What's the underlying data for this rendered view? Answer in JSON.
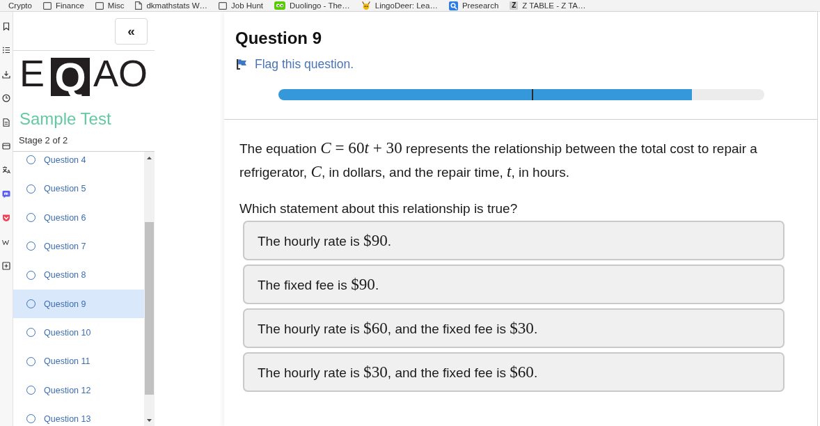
{
  "bookmarks_bar": {
    "items": [
      {
        "kind": "plain",
        "label": "Crypto"
      },
      {
        "kind": "folder",
        "label": "Finance"
      },
      {
        "kind": "folder",
        "label": "Misc"
      },
      {
        "kind": "page",
        "label": "dkmathstats W…"
      },
      {
        "kind": "folder",
        "label": "Job Hunt"
      },
      {
        "kind": "owl",
        "label": "Duolingo - The…"
      },
      {
        "kind": "deer",
        "label": "LingoDeer: Lea…"
      },
      {
        "kind": "tile",
        "label": "Presearch"
      },
      {
        "kind": "letter",
        "glyph": "Z",
        "label": "Z TABLE - Z TA…"
      }
    ]
  },
  "sidebar": {
    "collapse_button": "«",
    "logo": "EQAO",
    "title": "Sample Test",
    "stage": "Stage 2 of 2",
    "questions": [
      {
        "label": "Question 4",
        "selected": false
      },
      {
        "label": "Question 5",
        "selected": false
      },
      {
        "label": "Question 6",
        "selected": false
      },
      {
        "label": "Question 7",
        "selected": false
      },
      {
        "label": "Question 8",
        "selected": false
      },
      {
        "label": "Question 9",
        "selected": true
      },
      {
        "label": "Question 10",
        "selected": false
      },
      {
        "label": "Question 11",
        "selected": false
      },
      {
        "label": "Question 12",
        "selected": false
      },
      {
        "label": "Question 13",
        "selected": false
      }
    ]
  },
  "main": {
    "title": "Question 9",
    "flag_link": "Flag this question.",
    "progress": {
      "stages": [
        {
          "level": 1
        },
        {
          "level": 0.686
        }
      ]
    },
    "stem": [
      {
        "kind": "text",
        "text": "The equation "
      },
      {
        "kind": "var",
        "text": "C"
      },
      {
        "kind": "math",
        "text": " = 60"
      },
      {
        "kind": "var",
        "text": "t"
      },
      {
        "kind": "math",
        "text": " + 30"
      },
      {
        "kind": "text",
        "text": " represents the relationship between the total cost to repair a refrigerator, "
      },
      {
        "kind": "var",
        "text": "C"
      },
      {
        "kind": "text",
        "text": ", in dollars, and the repair time, "
      },
      {
        "kind": "var",
        "text": "t"
      },
      {
        "kind": "text",
        "text": ", in hours."
      }
    ],
    "prompt": "Which statement about this relationship is true?",
    "options": [
      {
        "selected": false,
        "parts": [
          {
            "kind": "text",
            "text": "The hourly rate is "
          },
          {
            "kind": "math",
            "text": "$90"
          },
          {
            "kind": "text",
            "text": "."
          }
        ]
      },
      {
        "selected": false,
        "parts": [
          {
            "kind": "text",
            "text": "The fixed fee is "
          },
          {
            "kind": "math",
            "text": "$90"
          },
          {
            "kind": "text",
            "text": "."
          }
        ]
      },
      {
        "selected": false,
        "parts": [
          {
            "kind": "text",
            "text": "The hourly rate is "
          },
          {
            "kind": "math",
            "text": "$60"
          },
          {
            "kind": "text",
            "text": ", and the fixed fee is "
          },
          {
            "kind": "math",
            "text": "$30"
          },
          {
            "kind": "text",
            "text": "."
          }
        ]
      },
      {
        "selected": false,
        "parts": [
          {
            "kind": "text",
            "text": "The hourly rate is "
          },
          {
            "kind": "math",
            "text": "$30"
          },
          {
            "kind": "text",
            "text": ", and the fixed fee is "
          },
          {
            "kind": "math",
            "text": "$60"
          },
          {
            "kind": "text",
            "text": "."
          }
        ]
      }
    ]
  }
}
